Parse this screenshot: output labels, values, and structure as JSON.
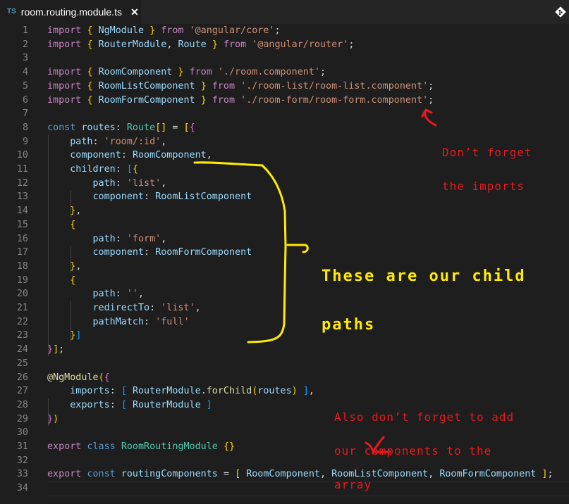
{
  "tab": {
    "language_badge": "TS",
    "file_name": "room.routing.module.ts",
    "close_glyph": "✕"
  },
  "toolbar": {
    "icon": "git-compare-icon"
  },
  "code_lines": [
    {
      "n": "1"
    },
    {
      "n": "2"
    },
    {
      "n": "3"
    },
    {
      "n": "4"
    },
    {
      "n": "5"
    },
    {
      "n": "6"
    },
    {
      "n": "7"
    },
    {
      "n": "8"
    },
    {
      "n": "9"
    },
    {
      "n": "10"
    },
    {
      "n": "11"
    },
    {
      "n": "12"
    },
    {
      "n": "13"
    },
    {
      "n": "14"
    },
    {
      "n": "15"
    },
    {
      "n": "16"
    },
    {
      "n": "17"
    },
    {
      "n": "18"
    },
    {
      "n": "19"
    },
    {
      "n": "20"
    },
    {
      "n": "21"
    },
    {
      "n": "22"
    },
    {
      "n": "23"
    },
    {
      "n": "24"
    },
    {
      "n": "25"
    },
    {
      "n": "26"
    },
    {
      "n": "27"
    },
    {
      "n": "28"
    },
    {
      "n": "29"
    },
    {
      "n": "30"
    },
    {
      "n": "31"
    },
    {
      "n": "32"
    },
    {
      "n": "33"
    },
    {
      "n": "34"
    }
  ],
  "code": {
    "l1": [
      [
        "kw",
        "import"
      ],
      [
        "pl",
        " "
      ],
      [
        "br1",
        "{"
      ],
      [
        "pl",
        " "
      ],
      [
        "id",
        "NgModule"
      ],
      [
        "pl",
        " "
      ],
      [
        "br1",
        "}"
      ],
      [
        "pl",
        " "
      ],
      [
        "kw",
        "from"
      ],
      [
        "pl",
        " "
      ],
      [
        "st",
        "'@angular/core'"
      ],
      [
        "pl",
        ";"
      ]
    ],
    "l2": [
      [
        "kw",
        "import"
      ],
      [
        "pl",
        " "
      ],
      [
        "br1",
        "{"
      ],
      [
        "pl",
        " "
      ],
      [
        "id",
        "RouterModule"
      ],
      [
        "pl",
        ", "
      ],
      [
        "id",
        "Route"
      ],
      [
        "pl",
        " "
      ],
      [
        "br1",
        "}"
      ],
      [
        "pl",
        " "
      ],
      [
        "kw",
        "from"
      ],
      [
        "pl",
        " "
      ],
      [
        "st",
        "'@angular/router'"
      ],
      [
        "pl",
        ";"
      ]
    ],
    "l3": [],
    "l4": [
      [
        "kw",
        "import"
      ],
      [
        "pl",
        " "
      ],
      [
        "br1",
        "{"
      ],
      [
        "pl",
        " "
      ],
      [
        "id",
        "RoomComponent"
      ],
      [
        "pl",
        " "
      ],
      [
        "br1",
        "}"
      ],
      [
        "pl",
        " "
      ],
      [
        "kw",
        "from"
      ],
      [
        "pl",
        " "
      ],
      [
        "st",
        "'./room.component'"
      ],
      [
        "pl",
        ";"
      ]
    ],
    "l5": [
      [
        "kw",
        "import"
      ],
      [
        "pl",
        " "
      ],
      [
        "br1",
        "{"
      ],
      [
        "pl",
        " "
      ],
      [
        "id",
        "RoomListComponent"
      ],
      [
        "pl",
        " "
      ],
      [
        "br1",
        "}"
      ],
      [
        "pl",
        " "
      ],
      [
        "kw",
        "from"
      ],
      [
        "pl",
        " "
      ],
      [
        "st",
        "'./room-list/room-list.component'"
      ],
      [
        "pl",
        ";"
      ]
    ],
    "l6": [
      [
        "kw",
        "import"
      ],
      [
        "pl",
        " "
      ],
      [
        "br1",
        "{"
      ],
      [
        "pl",
        " "
      ],
      [
        "id",
        "RoomFormComponent"
      ],
      [
        "pl",
        " "
      ],
      [
        "br1",
        "}"
      ],
      [
        "pl",
        " "
      ],
      [
        "kw",
        "from"
      ],
      [
        "pl",
        " "
      ],
      [
        "st",
        "'./room-form/room-form.component'"
      ],
      [
        "pl",
        ";"
      ]
    ],
    "l7": [],
    "l8": [
      [
        "kb",
        "const"
      ],
      [
        "pl",
        " "
      ],
      [
        "id",
        "routes"
      ],
      [
        "pl",
        ": "
      ],
      [
        "ty",
        "Route"
      ],
      [
        "br1",
        "[]"
      ],
      [
        "pl",
        " = "
      ],
      [
        "br1",
        "["
      ],
      [
        "br2",
        "{"
      ]
    ],
    "l9": [
      [
        "pl",
        "    "
      ],
      [
        "id",
        "path"
      ],
      [
        "pl",
        ": "
      ],
      [
        "st",
        "'room/:id'"
      ],
      [
        "pl",
        ","
      ]
    ],
    "l10": [
      [
        "pl",
        "    "
      ],
      [
        "id",
        "component"
      ],
      [
        "pl",
        ": "
      ],
      [
        "id",
        "RoomComponent"
      ],
      [
        "pl",
        ","
      ]
    ],
    "l11": [
      [
        "pl",
        "    "
      ],
      [
        "id",
        "children"
      ],
      [
        "pl",
        ": "
      ],
      [
        "br3",
        "["
      ],
      [
        "br1",
        "{"
      ]
    ],
    "l12": [
      [
        "pl",
        "        "
      ],
      [
        "id",
        "path"
      ],
      [
        "pl",
        ": "
      ],
      [
        "st",
        "'list'"
      ],
      [
        "pl",
        ","
      ]
    ],
    "l13": [
      [
        "pl",
        "        "
      ],
      [
        "id",
        "component"
      ],
      [
        "pl",
        ": "
      ],
      [
        "id",
        "RoomListComponent"
      ]
    ],
    "l14": [
      [
        "pl",
        "    "
      ],
      [
        "br1",
        "}"
      ],
      [
        "pl",
        ","
      ]
    ],
    "l15": [
      [
        "pl",
        "    "
      ],
      [
        "br1",
        "{"
      ]
    ],
    "l16": [
      [
        "pl",
        "        "
      ],
      [
        "id",
        "path"
      ],
      [
        "pl",
        ": "
      ],
      [
        "st",
        "'form'"
      ],
      [
        "pl",
        ","
      ]
    ],
    "l17": [
      [
        "pl",
        "        "
      ],
      [
        "id",
        "component"
      ],
      [
        "pl",
        ": "
      ],
      [
        "id",
        "RoomFormComponent"
      ]
    ],
    "l18": [
      [
        "pl",
        "    "
      ],
      [
        "br1",
        "}"
      ],
      [
        "pl",
        ","
      ]
    ],
    "l19": [
      [
        "pl",
        "    "
      ],
      [
        "br1",
        "{"
      ]
    ],
    "l20": [
      [
        "pl",
        "        "
      ],
      [
        "id",
        "path"
      ],
      [
        "pl",
        ": "
      ],
      [
        "st",
        "''"
      ],
      [
        "pl",
        ","
      ]
    ],
    "l21": [
      [
        "pl",
        "        "
      ],
      [
        "id",
        "redirectTo"
      ],
      [
        "pl",
        ": "
      ],
      [
        "st",
        "'list'"
      ],
      [
        "pl",
        ","
      ]
    ],
    "l22": [
      [
        "pl",
        "        "
      ],
      [
        "id",
        "pathMatch"
      ],
      [
        "pl",
        ": "
      ],
      [
        "st",
        "'full'"
      ]
    ],
    "l23": [
      [
        "pl",
        "    "
      ],
      [
        "br1",
        "}"
      ],
      [
        "br3",
        "]"
      ]
    ],
    "l24": [
      [
        "br2",
        "}"
      ],
      [
        "br1",
        "]"
      ],
      [
        "pl",
        ";"
      ]
    ],
    "l25": [],
    "l26": [
      [
        "fn",
        "@NgModule"
      ],
      [
        "br1",
        "("
      ],
      [
        "br2",
        "{"
      ]
    ],
    "l27": [
      [
        "pl",
        "    "
      ],
      [
        "id",
        "imports"
      ],
      [
        "pl",
        ": "
      ],
      [
        "br3",
        "["
      ],
      [
        "pl",
        " "
      ],
      [
        "id",
        "RouterModule"
      ],
      [
        "pl",
        "."
      ],
      [
        "fn",
        "forChild"
      ],
      [
        "br1",
        "("
      ],
      [
        "id",
        "routes"
      ],
      [
        "br1",
        ")"
      ],
      [
        "pl",
        " "
      ],
      [
        "br3",
        "]"
      ],
      [
        "pl",
        ","
      ]
    ],
    "l28": [
      [
        "pl",
        "    "
      ],
      [
        "id",
        "exports"
      ],
      [
        "pl",
        ": "
      ],
      [
        "br3",
        "["
      ],
      [
        "pl",
        " "
      ],
      [
        "id",
        "RouterModule"
      ],
      [
        "pl",
        " "
      ],
      [
        "br3",
        "]"
      ]
    ],
    "l29": [
      [
        "br2",
        "}"
      ],
      [
        "br1",
        ")"
      ]
    ],
    "l30": [],
    "l31": [
      [
        "kw",
        "export"
      ],
      [
        "pl",
        " "
      ],
      [
        "kb",
        "class"
      ],
      [
        "pl",
        " "
      ],
      [
        "ty",
        "RoomRoutingModule"
      ],
      [
        "pl",
        " "
      ],
      [
        "br1",
        "{}"
      ]
    ],
    "l32": [],
    "l33": [
      [
        "kw",
        "export"
      ],
      [
        "pl",
        " "
      ],
      [
        "kb",
        "const"
      ],
      [
        "pl",
        " "
      ],
      [
        "id",
        "routingComponents"
      ],
      [
        "pl",
        " = "
      ],
      [
        "br1",
        "["
      ],
      [
        "pl",
        " "
      ],
      [
        "id",
        "RoomComponent"
      ],
      [
        "pl",
        ", "
      ],
      [
        "id",
        "RoomListComponent"
      ],
      [
        "pl",
        ", "
      ],
      [
        "id",
        "RoomFormComponent"
      ],
      [
        "pl",
        " "
      ],
      [
        "br1",
        "]"
      ],
      [
        "pl",
        ";"
      ]
    ],
    "l34": []
  },
  "annotations": {
    "imports_note_line1": "Don’t forget",
    "imports_note_line2": "the imports",
    "child_paths_note_line1": "These are our child",
    "child_paths_note_line2": "paths",
    "array_note_line1": "Also don’t forget to add",
    "array_note_line2": "our components to the",
    "array_note_line3": "array",
    "colors": {
      "red": "#e8191e",
      "yellow": "#ffeb00"
    }
  },
  "theme": {
    "editor_bg": "#1e1e1e",
    "tabbar_bg": "#252526",
    "line_number": "#858585"
  }
}
